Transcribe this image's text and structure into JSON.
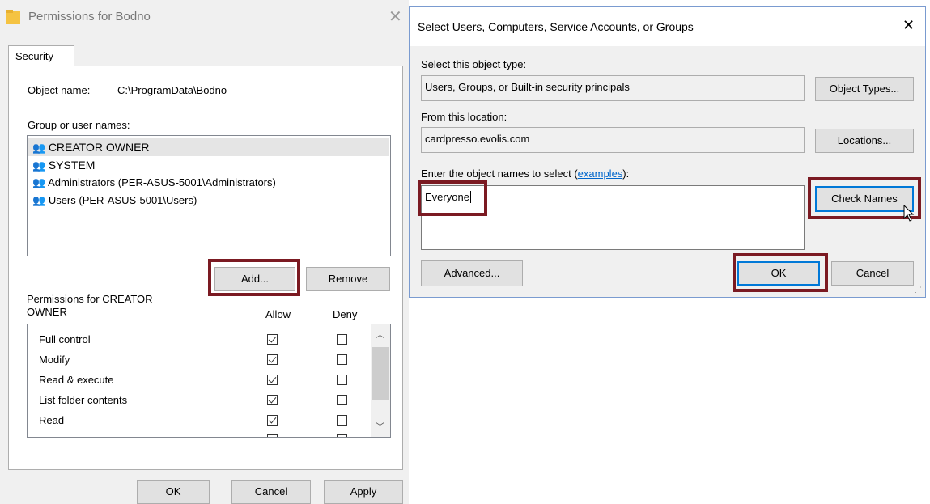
{
  "perm_dialog": {
    "title": "Permissions for Bodno",
    "tab": "Security",
    "object_name_label": "Object name:",
    "object_name_value": "C:\\ProgramData\\Bodno",
    "group_label": "Group or user names:",
    "users": [
      {
        "name": "CREATOR OWNER",
        "selected": true
      },
      {
        "name": "SYSTEM",
        "selected": false
      },
      {
        "name": "Administrators (PER-ASUS-5001\\Administrators)",
        "selected": false
      },
      {
        "name": "Users (PER-ASUS-5001\\Users)",
        "selected": false
      }
    ],
    "add_label": "Add...",
    "remove_label": "Remove",
    "permissions_for_line1": "Permissions for CREATOR",
    "permissions_for_line2": "OWNER",
    "allow_header": "Allow",
    "deny_header": "Deny",
    "permissions": [
      {
        "name": "Full control",
        "allow": true,
        "deny": false
      },
      {
        "name": "Modify",
        "allow": true,
        "deny": false
      },
      {
        "name": "Read & execute",
        "allow": true,
        "deny": false
      },
      {
        "name": "List folder contents",
        "allow": true,
        "deny": false
      },
      {
        "name": "Read",
        "allow": true,
        "deny": false
      }
    ],
    "ok_label": "OK",
    "cancel_label": "Cancel",
    "apply_label": "Apply"
  },
  "select_dialog": {
    "title": "Select Users, Computers, Service Accounts, or Groups",
    "object_type_label": "Select this object type:",
    "object_type_value": "Users, Groups, or Built-in security principals",
    "object_types_button": "Object Types...",
    "location_label": "From this location:",
    "location_value": "cardpresso.evolis.com",
    "locations_button": "Locations...",
    "enter_label": "Enter the object names to select (",
    "examples_link": "examples",
    "enter_label_end": "):",
    "names_value": "Everyone",
    "check_names_button": "Check Names",
    "advanced_button": "Advanced...",
    "ok_button": "OK",
    "cancel_button": "Cancel"
  },
  "colors": {
    "highlight": "#7b1a22",
    "focus": "#0078d7",
    "dialog_bg": "#f0f0f0"
  }
}
